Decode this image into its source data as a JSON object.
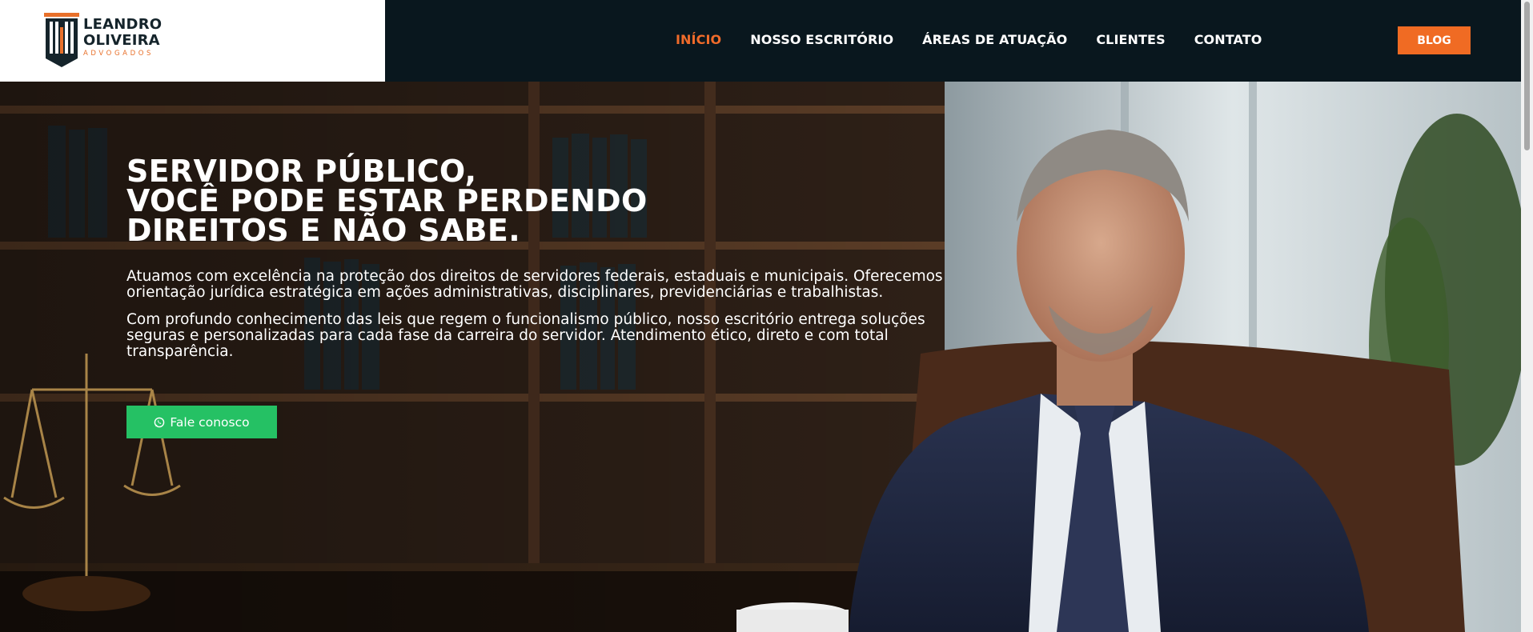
{
  "header": {
    "logo": {
      "line1": "LEANDRO",
      "line2": "OLIVEIRA",
      "line3": "ADVOGADOS"
    },
    "nav": [
      {
        "label": "INÍCIO",
        "active": true
      },
      {
        "label": "NOSSO ESCRITÓRIO",
        "active": false
      },
      {
        "label": "ÁREAS DE ATUAÇÃO",
        "active": false
      },
      {
        "label": "CLIENTES",
        "active": false
      },
      {
        "label": "CONTATO",
        "active": false
      }
    ],
    "blog_label": "BLOG"
  },
  "hero": {
    "title_lines": [
      "SERVIDOR PÚBLICO,",
      "VOCÊ PODE ESTAR PERDENDO",
      "DIREITOS E NÃO SABE."
    ],
    "paragraph1": "Atuamos com excelência na proteção dos direitos de servidores federais, estaduais e municipais. Oferecemos orientação jurídica estratégica em ações administrativas, disciplinares, previdenciárias e trabalhistas.",
    "paragraph2": "Com profundo conhecimento das leis que regem o funcionalismo público, nosso escritório entrega soluções seguras e personalizadas para cada fase da carreira do servidor. Atendimento ético, direto e com total transparência.",
    "cta_label": "Fale conosco",
    "cta_icon": "whatsapp-icon"
  },
  "colors": {
    "header_bg": "#09171e",
    "accent": "#f06b23",
    "cta": "#25c164",
    "text": "#ffffff"
  }
}
